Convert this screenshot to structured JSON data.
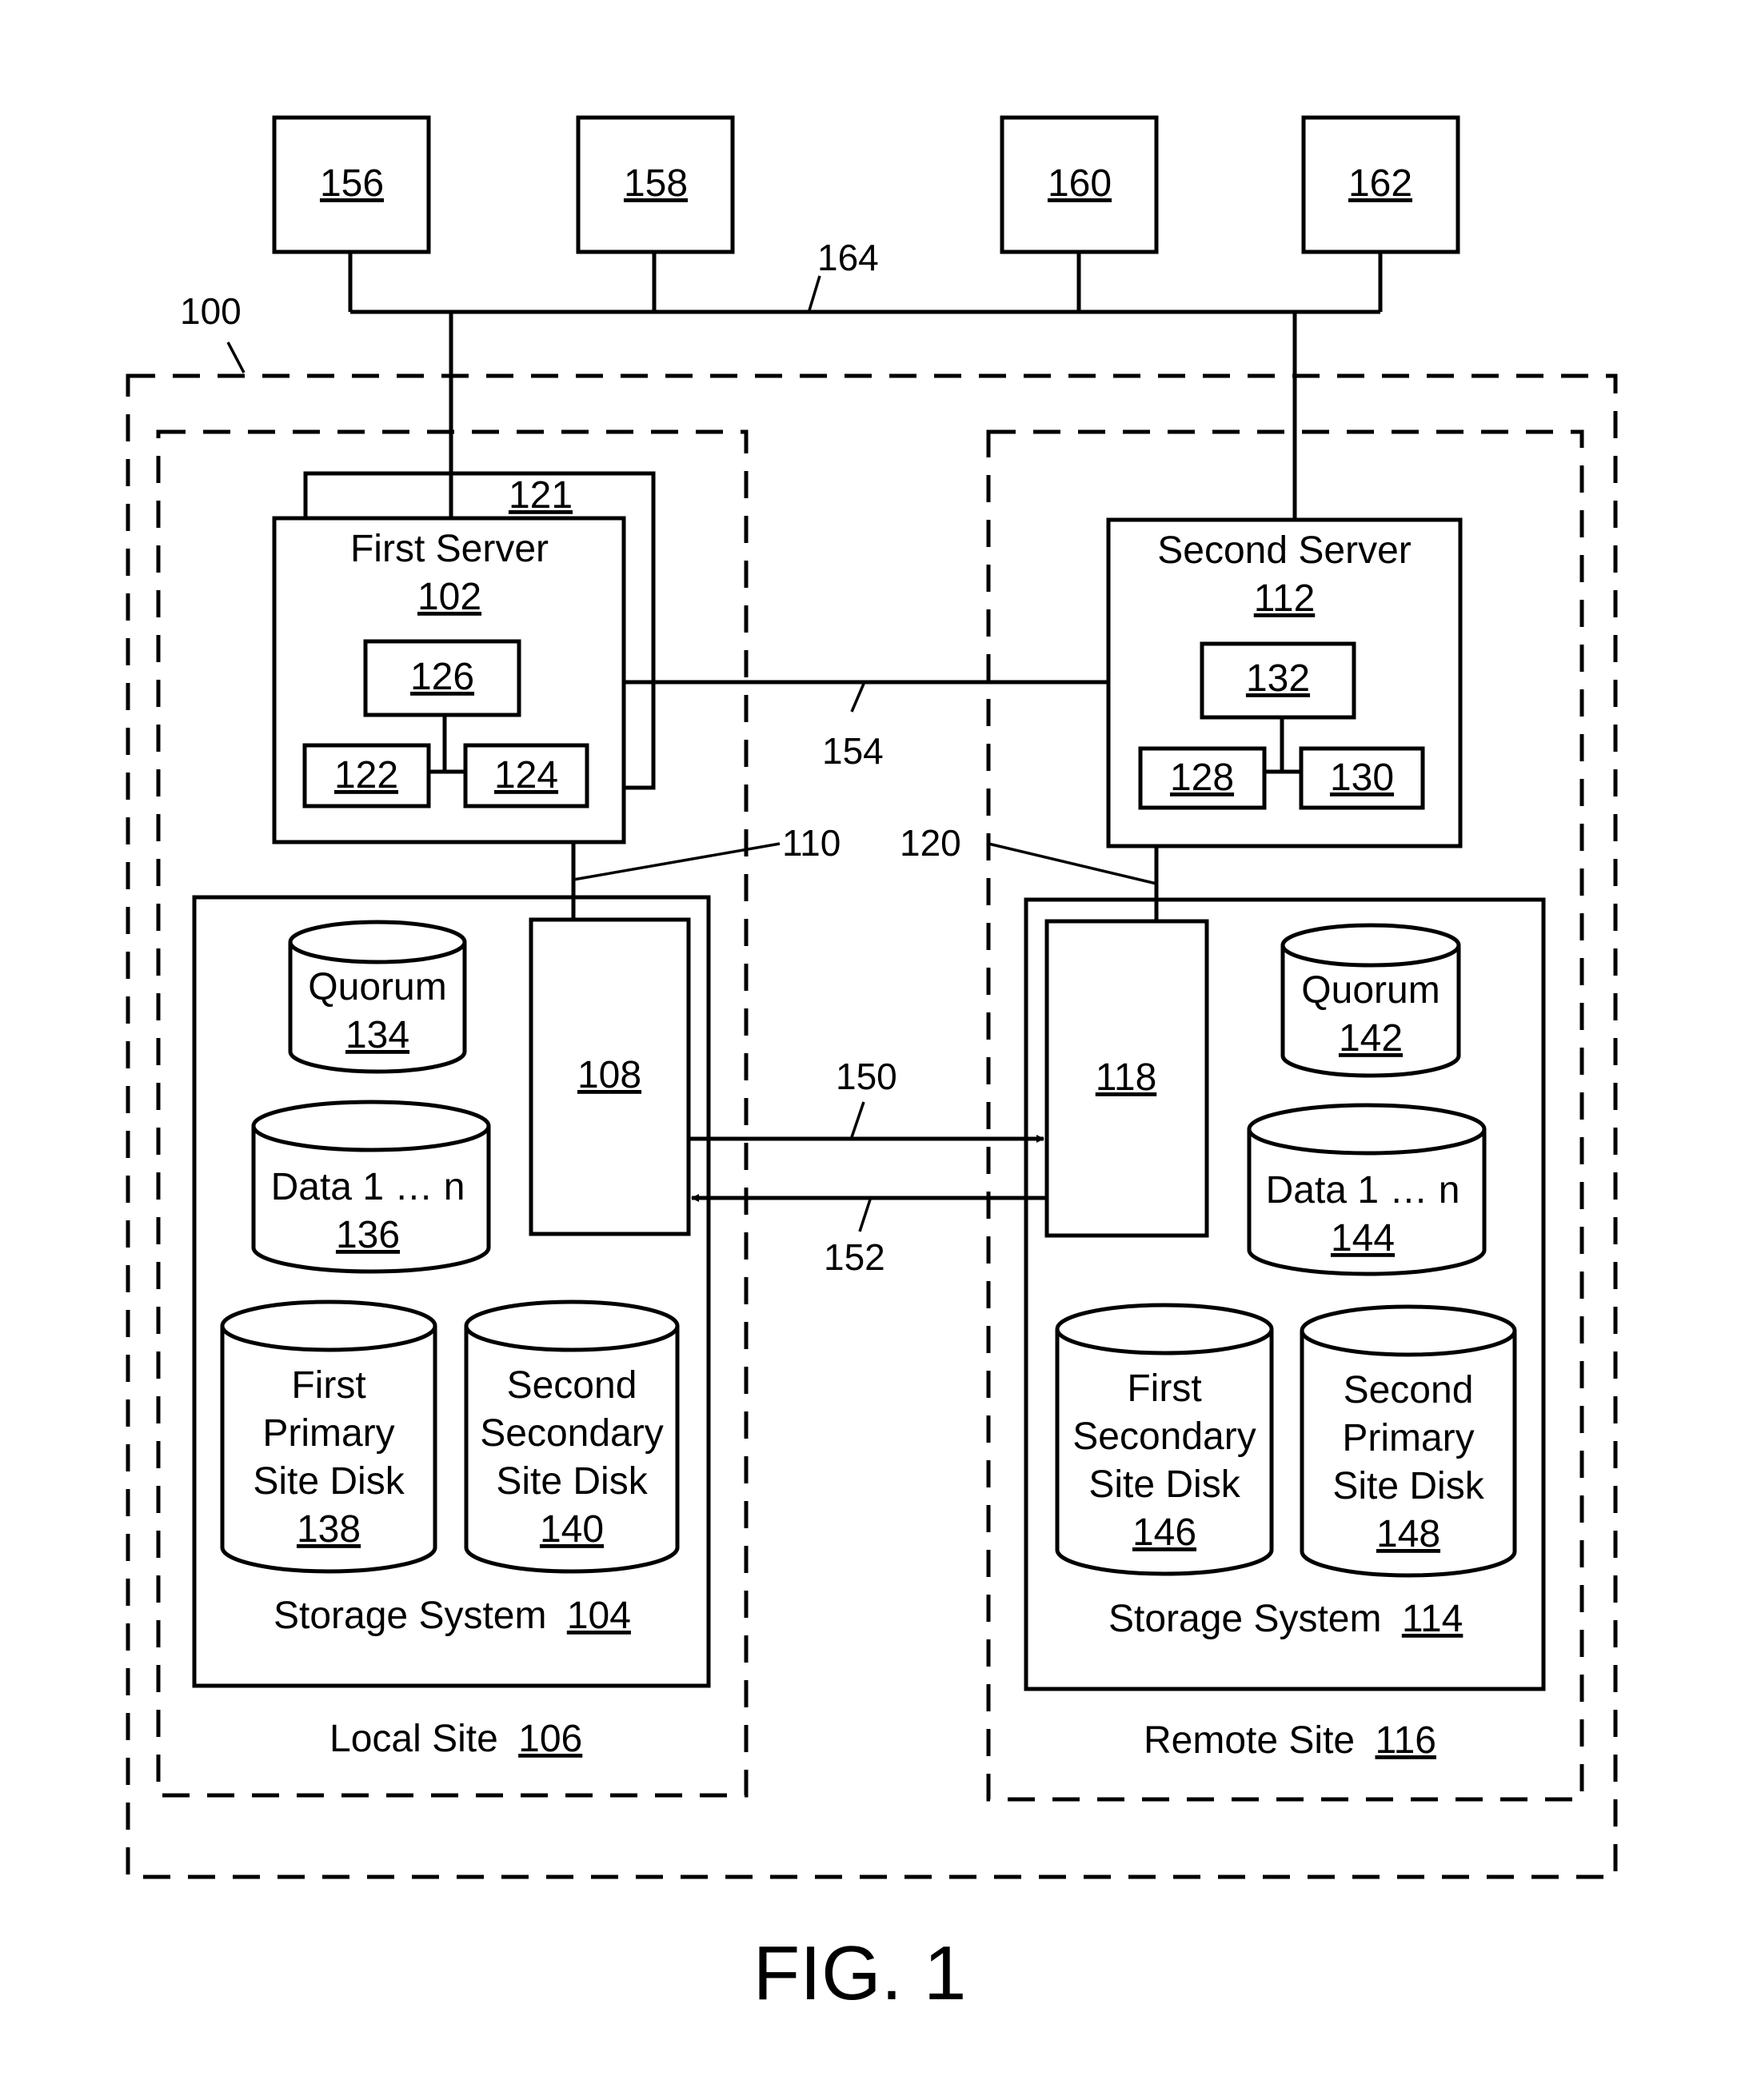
{
  "figure": {
    "caption": "FIG. 1",
    "system_ref": "100",
    "network_ref": "164",
    "clients": [
      {
        "ref": "156"
      },
      {
        "ref": "158"
      },
      {
        "ref": "160"
      },
      {
        "ref": "162"
      }
    ],
    "local_site": {
      "label": "Local Site",
      "ref": "106",
      "server": {
        "label": "First Server",
        "ref": "102",
        "backplane_ref": "121",
        "components": {
          "top": "126",
          "left": "122",
          "right": "124"
        }
      },
      "link_ref": "110",
      "storage": {
        "label": "Storage System",
        "ref": "104",
        "controller_ref": "108",
        "quorum": {
          "label": "Quorum",
          "ref": "134"
        },
        "data": {
          "label": "Data 1 … n",
          "ref": "136"
        },
        "disk_a": {
          "lines": [
            "First",
            "Primary",
            "Site Disk"
          ],
          "ref": "138"
        },
        "disk_b": {
          "lines": [
            "Second",
            "Secondary",
            "Site Disk"
          ],
          "ref": "140"
        }
      }
    },
    "remote_site": {
      "label": "Remote Site",
      "ref": "116",
      "server": {
        "label": "Second Server",
        "ref": "112",
        "components": {
          "top": "132",
          "left": "128",
          "right": "130"
        }
      },
      "link_ref": "120",
      "storage": {
        "label": "Storage System",
        "ref": "114",
        "controller_ref": "118",
        "quorum": {
          "label": "Quorum",
          "ref": "142"
        },
        "data": {
          "label": "Data 1 … n",
          "ref": "144"
        },
        "disk_a": {
          "lines": [
            "First",
            "Secondary",
            "Site Disk"
          ],
          "ref": "146"
        },
        "disk_b": {
          "lines": [
            "Second",
            "Primary",
            "Site Disk"
          ],
          "ref": "148"
        }
      }
    },
    "server_link_ref": "154",
    "replication_forward_ref": "150",
    "replication_reverse_ref": "152"
  }
}
